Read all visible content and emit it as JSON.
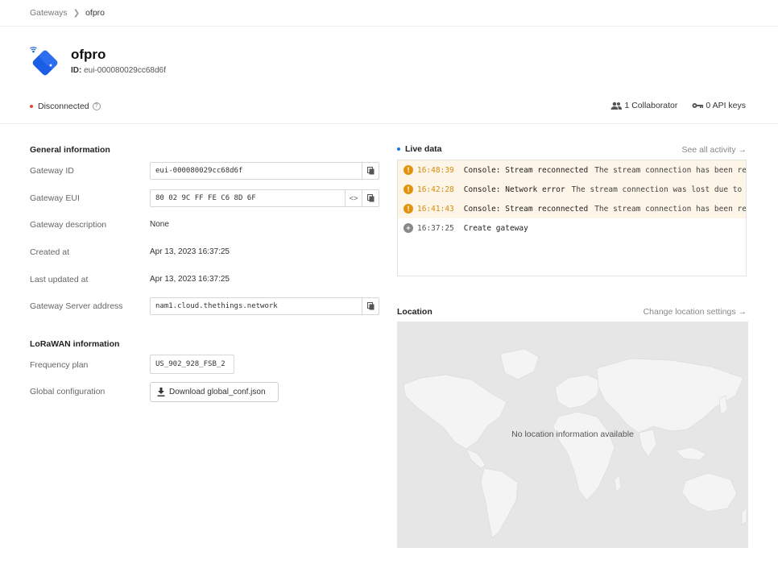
{
  "breadcrumb": {
    "parent": "Gateways",
    "current": "ofpro"
  },
  "gateway": {
    "name": "ofpro",
    "id_label": "ID:",
    "id_value": "eui-000080029cc68d6f",
    "status": "Disconnected",
    "collaborators": "1 Collaborator",
    "api_keys": "0 API keys"
  },
  "general": {
    "title": "General information",
    "gateway_id_label": "Gateway ID",
    "gateway_id": "eui-000080029cc68d6f",
    "gateway_eui_label": "Gateway EUI",
    "gateway_eui": "80 02 9C FF FE C6 8D 6F",
    "description_label": "Gateway description",
    "description": "None",
    "created_label": "Created at",
    "created": "Apr 13, 2023 16:37:25",
    "updated_label": "Last updated at",
    "updated": "Apr 13, 2023 16:37:25",
    "server_label": "Gateway Server address",
    "server": "nam1.cloud.thethings.network"
  },
  "lorawan": {
    "title": "LoRaWAN information",
    "frequency_label": "Frequency plan",
    "frequency": "US_902_928_FSB_2",
    "global_conf_label": "Global configuration",
    "download_label": "Download global_conf.json"
  },
  "live": {
    "title": "Live data",
    "see_all": "See all activity →",
    "events": [
      {
        "type": "warn",
        "time": "16:48:39",
        "name": "Console: Stream reconnected",
        "desc": "The stream connection has been re-established"
      },
      {
        "type": "warn",
        "time": "16:42:28",
        "name": "Console: Network error",
        "desc": "The stream connection was lost due to a network error"
      },
      {
        "type": "warn",
        "time": "16:41:43",
        "name": "Console: Stream reconnected",
        "desc": "The stream connection has been re-established"
      },
      {
        "type": "info",
        "time": "16:37:25",
        "name": "Create gateway",
        "desc": ""
      }
    ]
  },
  "location": {
    "title": "Location",
    "change": "Change location settings →",
    "empty": "No location information available"
  },
  "colors": {
    "accent": "#1a73e8",
    "warning": "#e0930c",
    "error": "#e0463c"
  }
}
